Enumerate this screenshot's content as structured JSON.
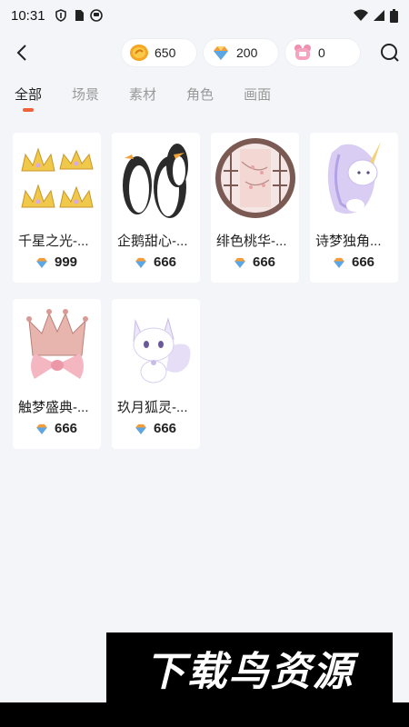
{
  "status": {
    "time": "10:31"
  },
  "header": {
    "gold_count": "650",
    "gem_count": "200",
    "bear_count": "0"
  },
  "tabs": [
    "全部",
    "场景",
    "素材",
    "角色",
    "画面"
  ],
  "items": [
    {
      "name": "千星之光-...",
      "price": "999",
      "icon": "crown-icon"
    },
    {
      "name": "企鹅甜心-...",
      "price": "666",
      "icon": "penguin-icon"
    },
    {
      "name": "绯色桃华-...",
      "price": "666",
      "icon": "round-window-icon"
    },
    {
      "name": "诗梦独角...",
      "price": "666",
      "icon": "unicorn-icon"
    },
    {
      "name": "触梦盛典-...",
      "price": "666",
      "icon": "bow-crown-icon"
    },
    {
      "name": "玖月狐灵-...",
      "price": "666",
      "icon": "fox-icon"
    }
  ],
  "watermark": "下载鸟资源",
  "colors": {
    "accent": "#f0613a",
    "background": "#f4f5f9"
  }
}
